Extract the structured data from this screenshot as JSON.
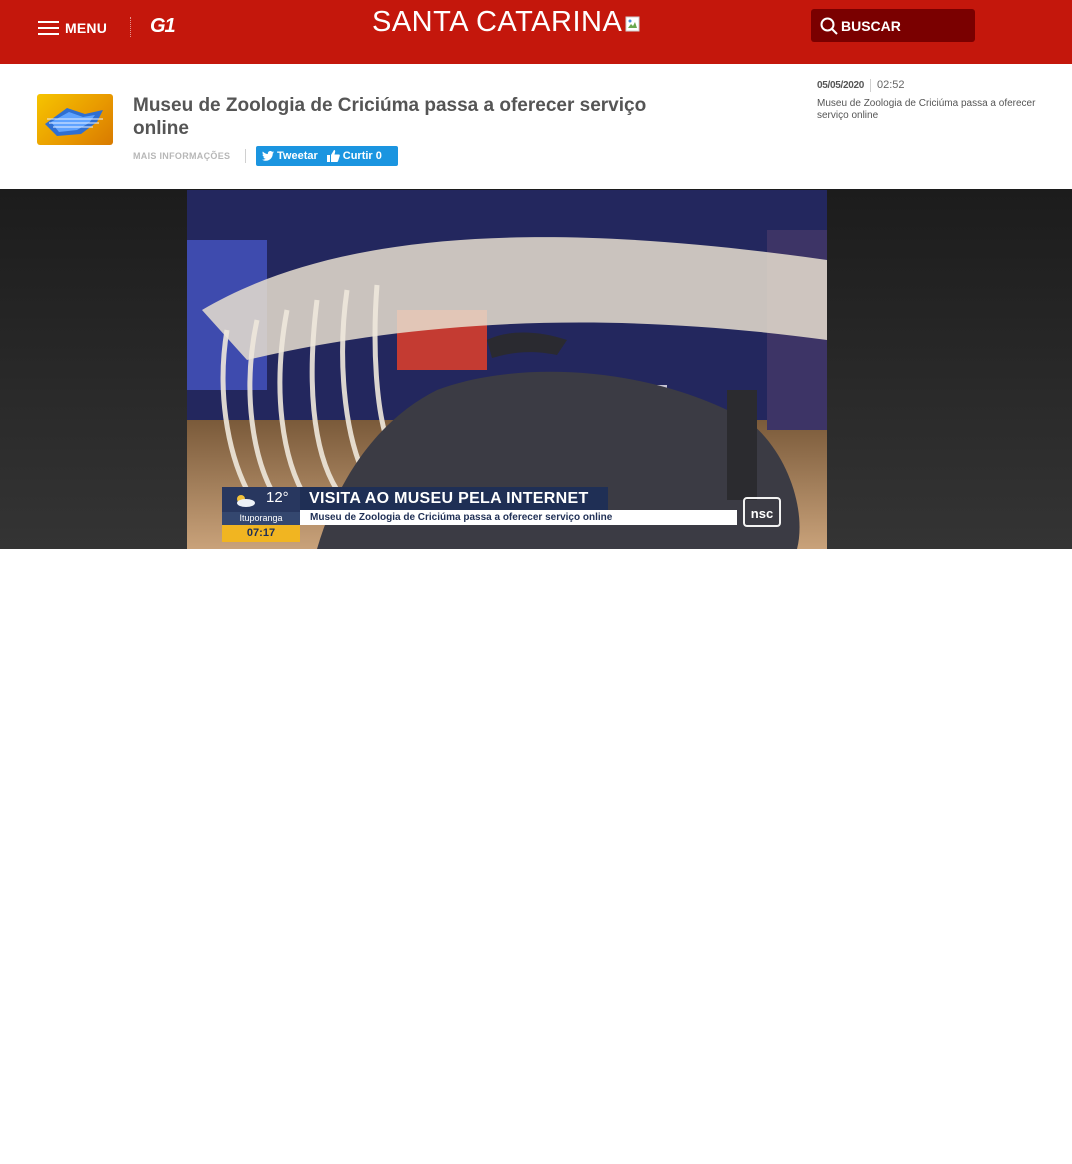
{
  "header": {
    "menu_label": "MENU",
    "logo_text": "G1",
    "region_title": "SANTA CATARINA",
    "search_label": "BUSCAR",
    "colors": {
      "brand_red": "#c4170c",
      "search_bg": "#7a0000"
    }
  },
  "video": {
    "title": "Museu de Zoologia de Criciúma passa a oferecer serviço online",
    "more_info_label": "MAIS INFORMAÇÕES",
    "tweet_label": "Tweetar",
    "like_label": "Curtir 0"
  },
  "sidebar": {
    "date": "05/05/2020",
    "duration": "02:52",
    "title": "Museu de Zoologia de Criciúma passa a oferecer serviço online"
  },
  "player": {
    "headline": "VISITA AO MUSEU PELA INTERNET",
    "subheadline": "Museu de Zoologia de Criciúma passa a oferecer serviço online",
    "temperature": "12°",
    "city": "Ituporanga",
    "time": "07:17",
    "broadcaster_logo": "nsc",
    "weather_icon": "cloudy-sun-icon"
  }
}
